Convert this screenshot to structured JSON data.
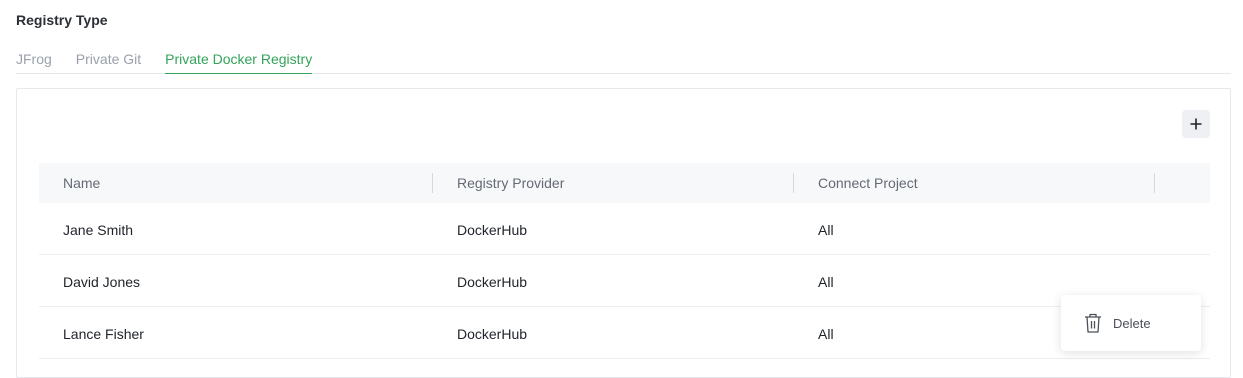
{
  "section": {
    "title": "Registry Type"
  },
  "tabs": [
    {
      "label": "JFrog",
      "active": false
    },
    {
      "label": "Private Git",
      "active": false
    },
    {
      "label": "Private Docker Registry",
      "active": true
    }
  ],
  "toolbar": {
    "add_icon": "plus-icon"
  },
  "table": {
    "columns": [
      "Name",
      "Registry Provider",
      "Connect Project"
    ],
    "rows": [
      {
        "name": "Jane Smith",
        "provider": "DockerHub",
        "project": "All"
      },
      {
        "name": "David Jones",
        "provider": "DockerHub",
        "project": "All"
      },
      {
        "name": "Lance Fisher",
        "provider": "DockerHub",
        "project": "All"
      }
    ]
  },
  "context_menu": {
    "delete_label": "Delete",
    "icon": "trash-icon"
  },
  "colors": {
    "accent": "#33a35a"
  }
}
